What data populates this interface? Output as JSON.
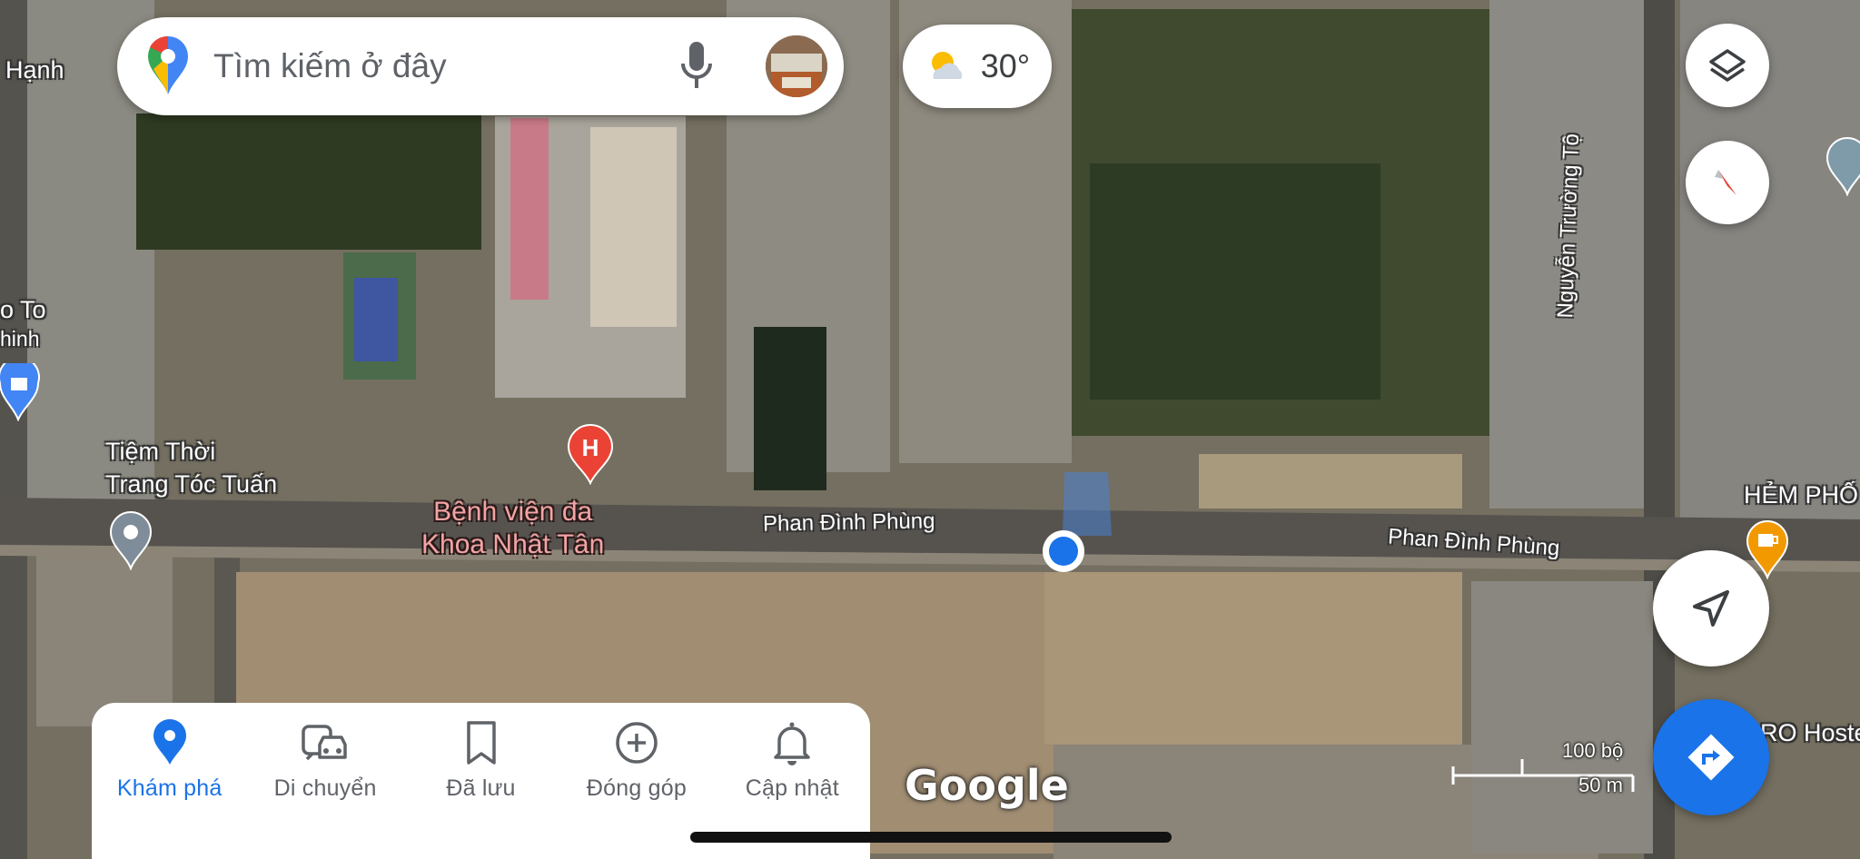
{
  "search": {
    "placeholder": "Tìm kiếm ở đây"
  },
  "weather": {
    "temperature": "30°",
    "icon": "partly-sunny-icon"
  },
  "map": {
    "place_labels": [
      {
        "id": "hanh",
        "text": "Hạnh"
      },
      {
        "id": "to-to",
        "text": "o To"
      },
      {
        "id": "hinh",
        "text": "hinh"
      },
      {
        "id": "tiem-line1",
        "text": "Tiệm Thời"
      },
      {
        "id": "tiem-line2",
        "text": "Trang Tóc Tuấn"
      },
      {
        "id": "hem-pho",
        "text": "HẺM PHỐ"
      },
      {
        "id": "ro-hostel",
        "text": "RO Hoste"
      }
    ],
    "hospital": {
      "line1": "Bệnh viện đa",
      "line2": "Khoa Nhật Tân"
    },
    "roads": {
      "phan1": "Phan Đình Phùng",
      "phan2": "Phan Đình Phùng",
      "nguyen": "Nguyễn Trường Tộ"
    },
    "google_logo": "Google",
    "scale": {
      "top": "100 bộ",
      "bottom": "50 m"
    }
  },
  "nav": {
    "tabs": [
      {
        "label": "Khám phá",
        "icon": "location-pin-icon",
        "active": true
      },
      {
        "label": "Di chuyển",
        "icon": "commute-icon",
        "active": false
      },
      {
        "label": "Đã lưu",
        "icon": "bookmark-icon",
        "active": false
      },
      {
        "label": "Đóng góp",
        "icon": "add-circle-icon",
        "active": false
      },
      {
        "label": "Cập nhật",
        "icon": "bell-icon",
        "active": false
      }
    ]
  },
  "colors": {
    "accent": "#1a73e8",
    "hospital_marker": "#ea4335",
    "cafe_marker": "#f29900"
  }
}
